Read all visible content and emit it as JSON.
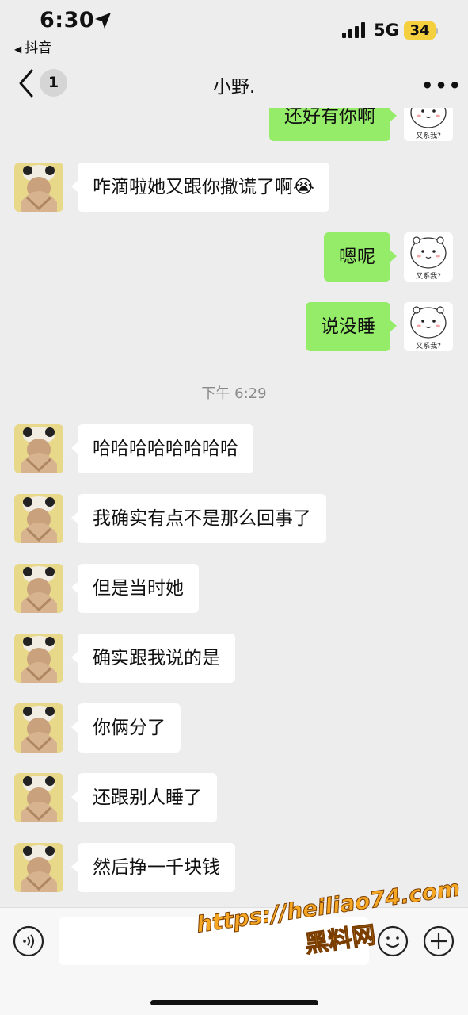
{
  "status_bar": {
    "time": "6:30",
    "back_app": "抖音",
    "network": "5G",
    "battery": "34"
  },
  "nav": {
    "unread": "1",
    "title": "小野.",
    "more": "•••"
  },
  "sticker_caption": "又系我?",
  "messages": [
    {
      "side": "out",
      "text": "还好有你啊"
    },
    {
      "side": "in",
      "text": "咋滴啦她又跟你撒谎了啊😭"
    },
    {
      "side": "out",
      "text": "嗯呢"
    },
    {
      "side": "out",
      "text": "说没睡"
    },
    {
      "side": "in",
      "text": "哈哈哈哈哈哈哈哈"
    },
    {
      "side": "in",
      "text": "我确实有点不是那么回事了"
    },
    {
      "side": "in",
      "text": "但是当时她"
    },
    {
      "side": "in",
      "text": "确实跟我说的是"
    },
    {
      "side": "in",
      "text": "你俩分了"
    },
    {
      "side": "in",
      "text": "还跟别人睡了"
    },
    {
      "side": "in",
      "text": "然后挣一千块钱"
    }
  ],
  "timestamp": "下午 6:29",
  "watermark": {
    "url": "https://heiliao74.com",
    "name": "黑料网"
  },
  "colors": {
    "background": "#ededed",
    "bubble_out": "#95ec69",
    "bubble_in": "#ffffff",
    "battery": "#f4d03f",
    "watermark": "#f5a623"
  },
  "icons": [
    "location-arrow-icon",
    "signal-icon",
    "chevron-left-icon",
    "voice-icon",
    "emoji-icon",
    "plus-icon",
    "more-icon"
  ]
}
